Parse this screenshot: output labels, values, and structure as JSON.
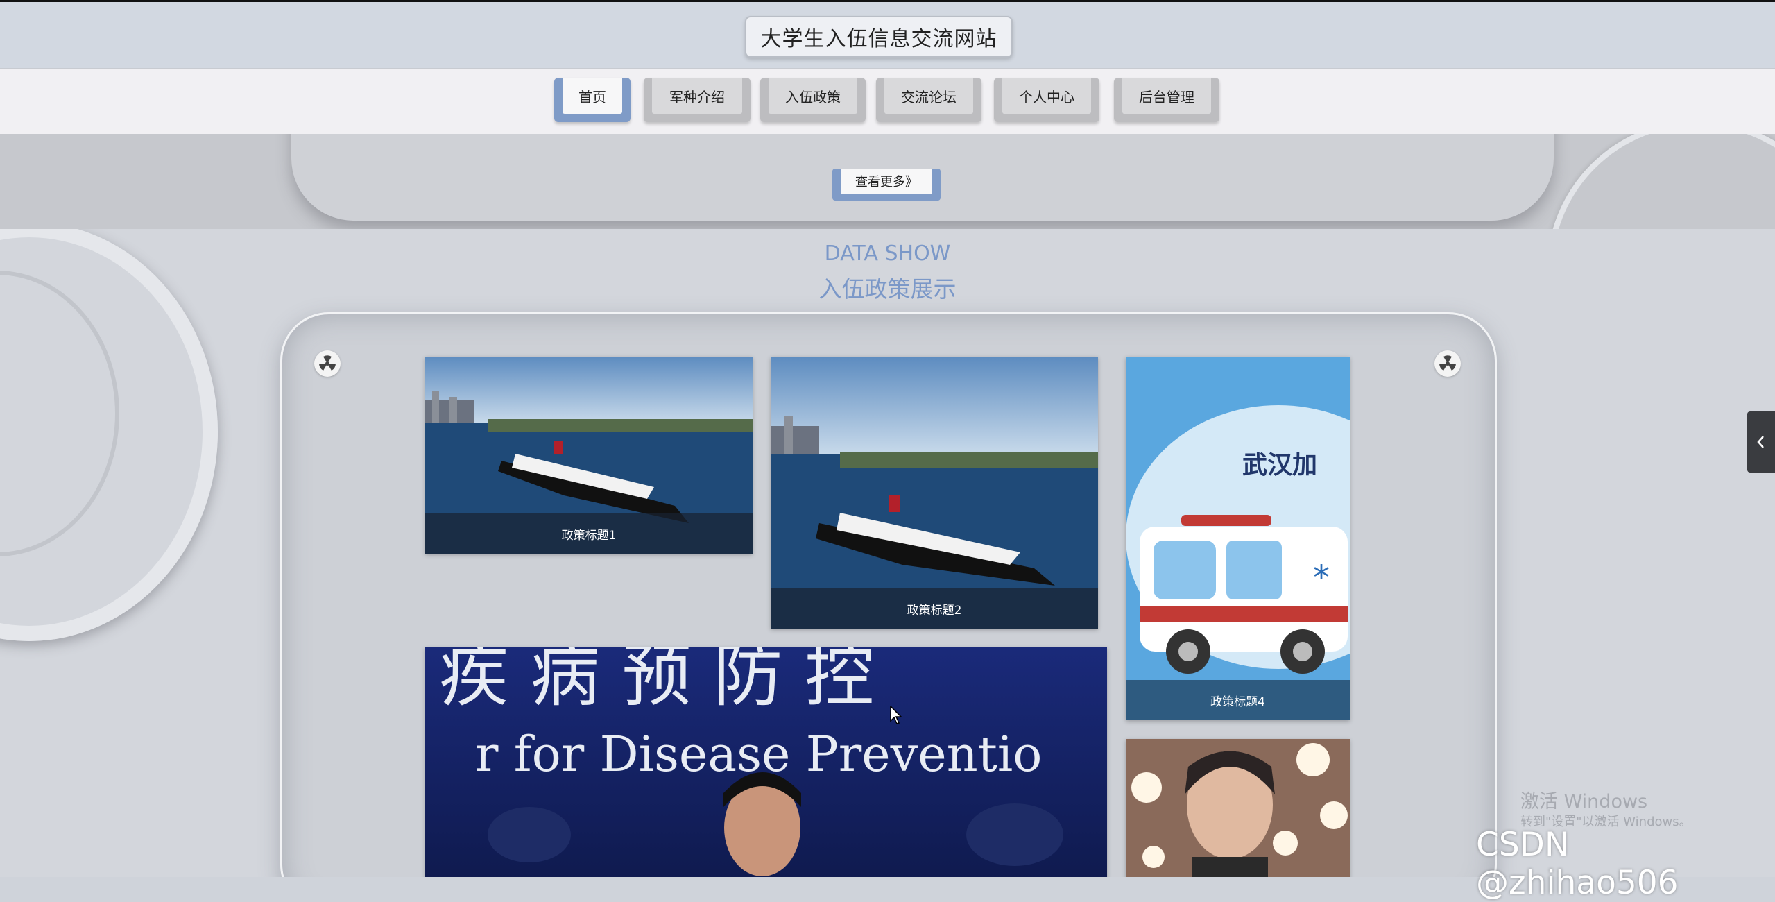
{
  "header": {
    "site_title": "大学生入伍信息交流网站"
  },
  "nav": {
    "items": [
      {
        "label": "首页",
        "active": true
      },
      {
        "label": "军种介绍",
        "active": false
      },
      {
        "label": "入伍政策",
        "active": false
      },
      {
        "label": "交流论坛",
        "active": false
      },
      {
        "label": "个人中心",
        "active": false
      },
      {
        "label": "后台管理",
        "active": false
      }
    ]
  },
  "banner": {
    "more_label": "查看更多》"
  },
  "section": {
    "title_en": "DATA SHOW",
    "title_cn": "入伍政策展示"
  },
  "cards": [
    {
      "caption": "政策标题1",
      "image": "cruise-ship-photo"
    },
    {
      "caption": "政策标题2",
      "image": "cruise-ship-photo"
    },
    {
      "caption": "",
      "image": "press-conference-photo",
      "photo_text_line1": "疾 病 预 防 控",
      "photo_text_line2": "r for Disease Preventio"
    },
    {
      "caption": "政策标题4",
      "image": "ambulance-illustration",
      "photo_text": "武汉加"
    },
    {
      "caption": "",
      "image": "portrait-photo"
    }
  ],
  "overlay": {
    "activate_title": "激活 Windows",
    "activate_sub": "转到\"设置\"以激活 Windows。",
    "csdn_watermark": "CSDN @zhihao506"
  },
  "colors": {
    "accent": "#7b98c8",
    "nav_active": "#7f9bc7",
    "caption_bg": "#2e5b80"
  }
}
